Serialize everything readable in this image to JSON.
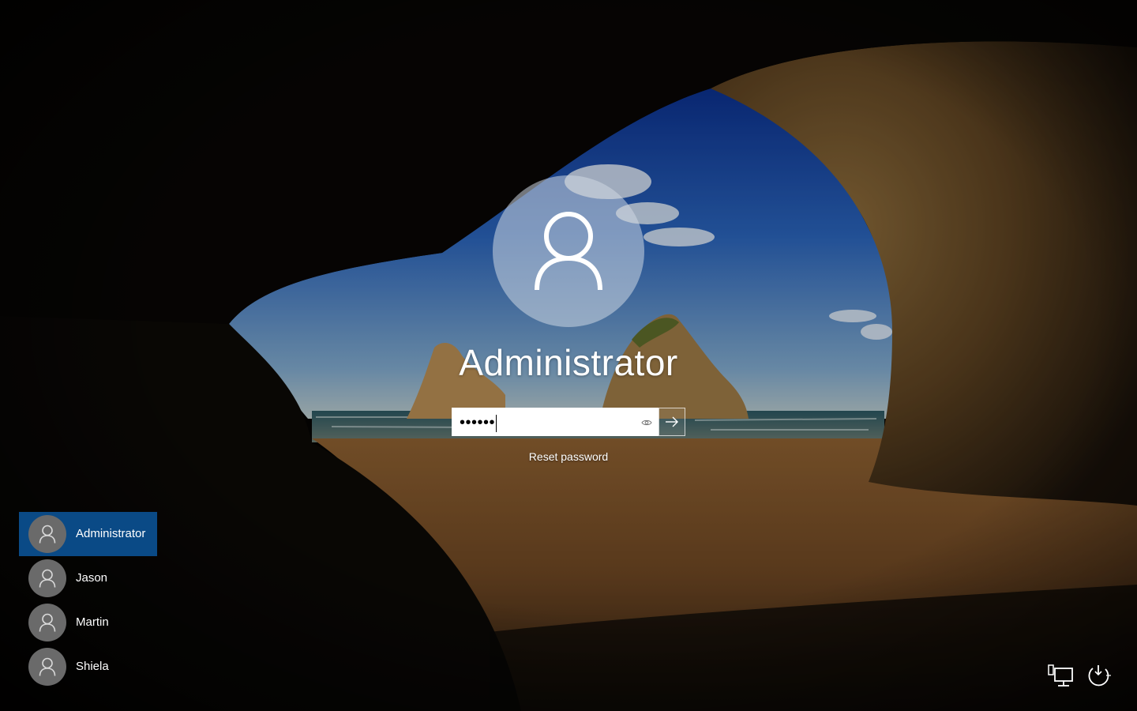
{
  "login": {
    "username": "Administrator",
    "password_masked": "••••••",
    "submit_icon": "arrow-right-icon",
    "reveal_icon": "eye-icon",
    "reset_password_label": "Reset password",
    "avatar_icon": "user-icon"
  },
  "users": [
    {
      "name": "Administrator",
      "selected": true
    },
    {
      "name": "Jason",
      "selected": false
    },
    {
      "name": "Martin",
      "selected": false
    },
    {
      "name": "Shiela",
      "selected": false
    }
  ],
  "tray": {
    "network_icon": "network-icon",
    "power_icon": "power-icon"
  },
  "colors": {
    "selected_user_bg": "#0a4a86",
    "avatar_bg": "#6a6a6a"
  }
}
